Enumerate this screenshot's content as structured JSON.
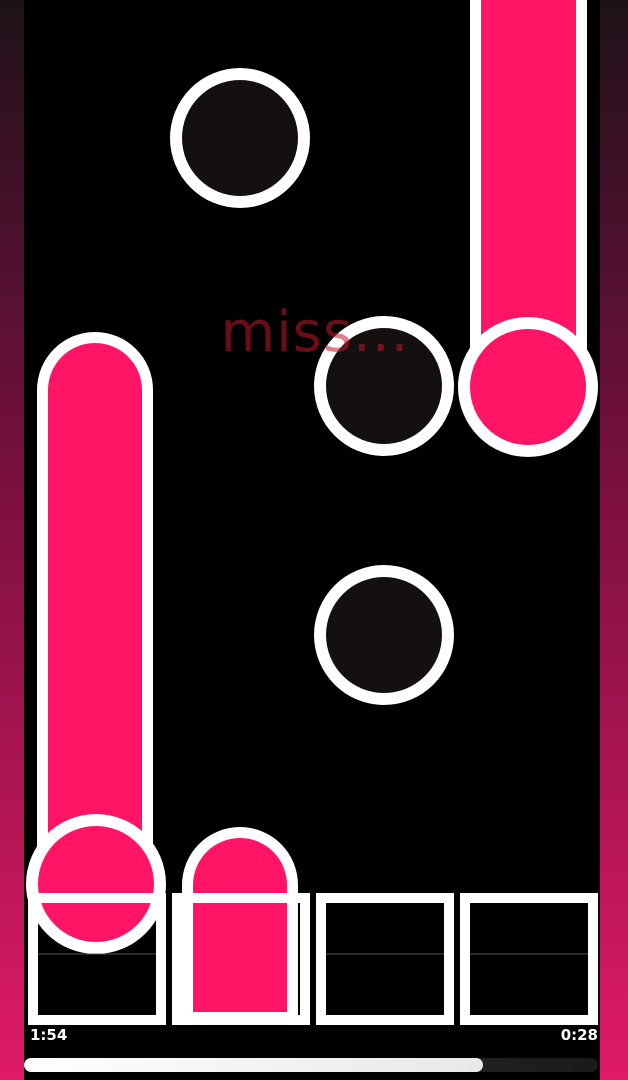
{
  "game": {
    "judgement": "miss...",
    "time_elapsed": "1:54",
    "time_remaining": "0:28",
    "progress": 0.8,
    "colors": {
      "accent": "#ff1466",
      "note_fill": "#141010",
      "outline": "#ffffff",
      "background": "#000000"
    },
    "lanes": [
      {
        "index": 1,
        "pressed": false
      },
      {
        "index": 2,
        "pressed": true
      },
      {
        "index": 3,
        "pressed": false
      },
      {
        "index": 4,
        "pressed": false
      }
    ]
  }
}
